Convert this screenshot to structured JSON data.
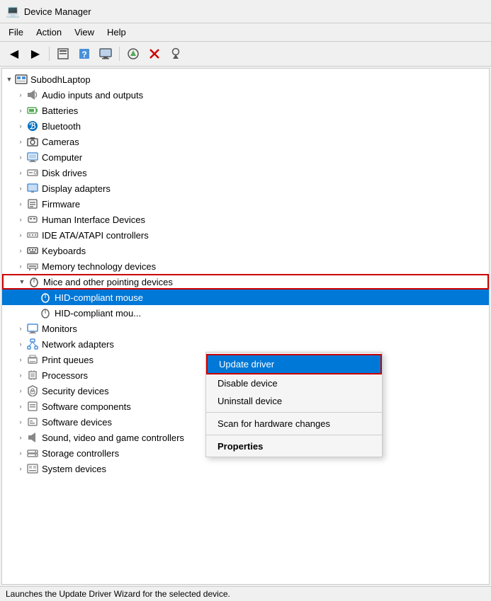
{
  "titleBar": {
    "title": "Device Manager",
    "icon": "💻"
  },
  "menuBar": {
    "items": [
      "File",
      "Action",
      "View",
      "Help"
    ]
  },
  "toolbar": {
    "buttons": [
      {
        "name": "back-btn",
        "icon": "◀",
        "label": "Back"
      },
      {
        "name": "forward-btn",
        "icon": "▶",
        "label": "Forward"
      },
      {
        "name": "properties-btn",
        "icon": "📋",
        "label": "Properties"
      },
      {
        "name": "help-btn",
        "icon": "❓",
        "label": "Help"
      },
      {
        "name": "driver-btn",
        "icon": "🖥",
        "label": "Update Driver"
      },
      {
        "name": "remove-btn",
        "icon": "❌",
        "label": "Remove"
      },
      {
        "name": "scan-btn",
        "icon": "⬇",
        "label": "Scan"
      }
    ]
  },
  "tree": {
    "root": "SubodhLaptop",
    "items": [
      {
        "label": "Audio inputs and outputs",
        "icon": "🔊",
        "indent": 1,
        "expanded": false
      },
      {
        "label": "Batteries",
        "icon": "🔋",
        "indent": 1,
        "expanded": false
      },
      {
        "label": "Bluetooth",
        "icon": "🔵",
        "indent": 1,
        "expanded": false
      },
      {
        "label": "Cameras",
        "icon": "📷",
        "indent": 1,
        "expanded": false
      },
      {
        "label": "Computer",
        "icon": "🖥",
        "indent": 1,
        "expanded": false
      },
      {
        "label": "Disk drives",
        "icon": "💽",
        "indent": 1,
        "expanded": false
      },
      {
        "label": "Display adapters",
        "icon": "🖥",
        "indent": 1,
        "expanded": false
      },
      {
        "label": "Firmware",
        "icon": "📦",
        "indent": 1,
        "expanded": false
      },
      {
        "label": "Human Interface Devices",
        "icon": "⌨",
        "indent": 1,
        "expanded": false
      },
      {
        "label": "IDE ATA/ATAPI controllers",
        "icon": "💽",
        "indent": 1,
        "expanded": false
      },
      {
        "label": "Keyboards",
        "icon": "⌨",
        "indent": 1,
        "expanded": false
      },
      {
        "label": "Memory technology devices",
        "icon": "💾",
        "indent": 1,
        "expanded": false
      },
      {
        "label": "Mice and other pointing devices",
        "icon": "🖱",
        "indent": 1,
        "expanded": true,
        "selected": true
      },
      {
        "label": "HID-compliant mouse",
        "icon": "🖱",
        "indent": 2,
        "expanded": false
      },
      {
        "label": "HID-compliant mou...",
        "icon": "🖱",
        "indent": 2,
        "expanded": false
      },
      {
        "label": "Monitors",
        "icon": "🖥",
        "indent": 1,
        "expanded": false
      },
      {
        "label": "Network adapters",
        "icon": "🌐",
        "indent": 1,
        "expanded": false
      },
      {
        "label": "Print queues",
        "icon": "🖨",
        "indent": 1,
        "expanded": false
      },
      {
        "label": "Processors",
        "icon": "🔧",
        "indent": 1,
        "expanded": false
      },
      {
        "label": "Security devices",
        "icon": "🔒",
        "indent": 1,
        "expanded": false
      },
      {
        "label": "Software components",
        "icon": "📦",
        "indent": 1,
        "expanded": false
      },
      {
        "label": "Software devices",
        "icon": "📦",
        "indent": 1,
        "expanded": false
      },
      {
        "label": "Sound, video and game controllers",
        "icon": "🔊",
        "indent": 1,
        "expanded": false
      },
      {
        "label": "Storage controllers",
        "icon": "💽",
        "indent": 1,
        "expanded": false
      },
      {
        "label": "System devices",
        "icon": "🖥",
        "indent": 1,
        "expanded": false
      }
    ]
  },
  "contextMenu": {
    "items": [
      {
        "label": "Update driver",
        "bold": false,
        "active": true
      },
      {
        "label": "Disable device",
        "bold": false,
        "active": false
      },
      {
        "label": "Uninstall device",
        "bold": false,
        "active": false
      },
      {
        "label": "Scan for hardware changes",
        "bold": false,
        "active": false
      },
      {
        "label": "Properties",
        "bold": true,
        "active": false
      }
    ]
  },
  "statusBar": {
    "text": "Launches the Update Driver Wizard for the selected device."
  }
}
